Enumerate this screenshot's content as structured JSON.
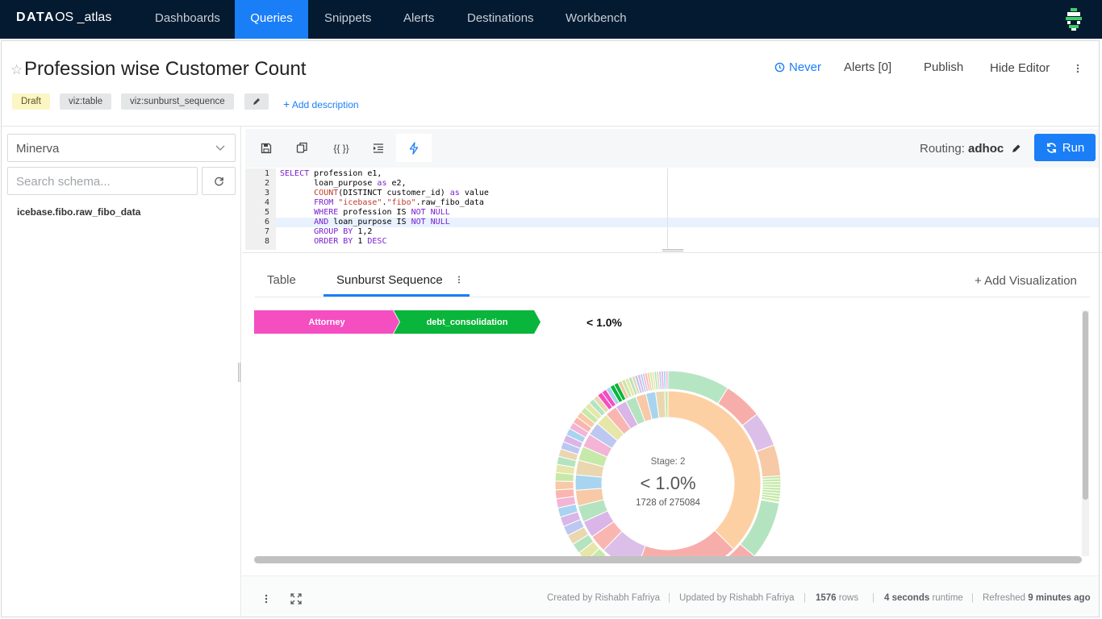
{
  "nav": {
    "brand_bold": "DATA",
    "brand_thin": "OS _atlas",
    "items": [
      "Dashboards",
      "Queries",
      "Snippets",
      "Alerts",
      "Destinations",
      "Workbench"
    ],
    "active": "Queries"
  },
  "query": {
    "title": "Profession wise Customer Count",
    "tags": [
      "Draft",
      "viz:table",
      "viz:sunburst_sequence"
    ],
    "add_description": "Add description",
    "actions": {
      "schedule": "Never",
      "alerts": "Alerts [0]",
      "publish": "Publish",
      "hide_editor": "Hide Editor"
    }
  },
  "schema": {
    "source": "Minerva",
    "search_placeholder": "Search schema...",
    "tables": [
      "icebase.fibo.raw_fibo_data"
    ]
  },
  "editor": {
    "routing_label": "Routing:",
    "routing_value": "adhoc",
    "run_label": "Run",
    "format_label": "{{ }}",
    "line_numbers": [
      "1",
      "2",
      "3",
      "4",
      "5",
      "6",
      "7",
      "8"
    ]
  },
  "results": {
    "tabs": [
      "Table",
      "Sunburst Sequence"
    ],
    "active_tab": "Sunburst Sequence",
    "add_visualization": "+ Add Visualization"
  },
  "sunburst": {
    "breadcrumb": [
      {
        "label": "Attorney",
        "color": "#f54ec1"
      },
      {
        "label": "debt_consolidation",
        "color": "#09b53a"
      }
    ],
    "percentage_top": "< 1.0%",
    "stage_label": "Stage: 2",
    "percentage_center": "< 1.0%",
    "count_label": "1728 of 275084"
  },
  "footer": {
    "created_by": "Created by Rishabh Fafriya",
    "updated_by": "Updated by Rishabh Fafriya",
    "rows_value": "1576",
    "rows_label": "rows",
    "runtime_value": "4 seconds",
    "runtime_label": "runtime",
    "refreshed_label": "Refreshed",
    "refreshed_value": "9 minutes ago"
  }
}
